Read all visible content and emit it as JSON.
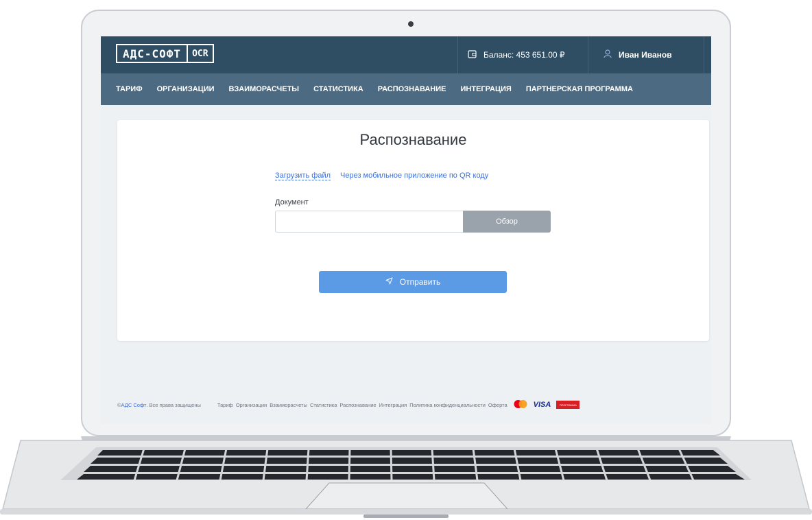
{
  "header": {
    "logo_main": "АДС-СОФТ",
    "logo_tag": "OCR",
    "balance": "Баланс: 453 651.00 ₽",
    "user_name": "Иван Иванов"
  },
  "nav": {
    "items": [
      {
        "label": "ТАРИФ"
      },
      {
        "label": "ОРГАНИЗАЦИИ"
      },
      {
        "label": "ВЗАИМОРАСЧЕТЫ"
      },
      {
        "label": "СТАТИСТИКА"
      },
      {
        "label": "РАСПОЗНАВАНИЕ"
      },
      {
        "label": "ИНТЕГРАЦИЯ"
      },
      {
        "label": "ПАРТНЕРСКАЯ ПРОГРАММА"
      }
    ]
  },
  "main": {
    "title": "Распознавание",
    "tabs": [
      {
        "label": "Загрузить файл"
      },
      {
        "label": "Через мобильное приложение по QR коду"
      }
    ],
    "document_label": "Документ",
    "file_value": "",
    "browse_label": "Обзор",
    "submit_label": "Отправить"
  },
  "footer": {
    "copyright_prefix": "© ",
    "brand": "АДС Софт",
    "rights": ". Все права защищены",
    "links": [
      {
        "label": "Тариф"
      },
      {
        "label": "Организации"
      },
      {
        "label": "Взаиморасчеты"
      },
      {
        "label": "Статистика"
      },
      {
        "label": "Распознавание"
      },
      {
        "label": "Интеграция"
      },
      {
        "label": "Политика конфиденциальности"
      },
      {
        "label": "Оферта"
      }
    ],
    "visa": "VISA",
    "mir": "ПРОГРАММА"
  },
  "colors": {
    "topbar": "#2f4d63",
    "navbar": "#4c6b82",
    "accent": "#5b9be6",
    "link": "#3a6fd8"
  }
}
